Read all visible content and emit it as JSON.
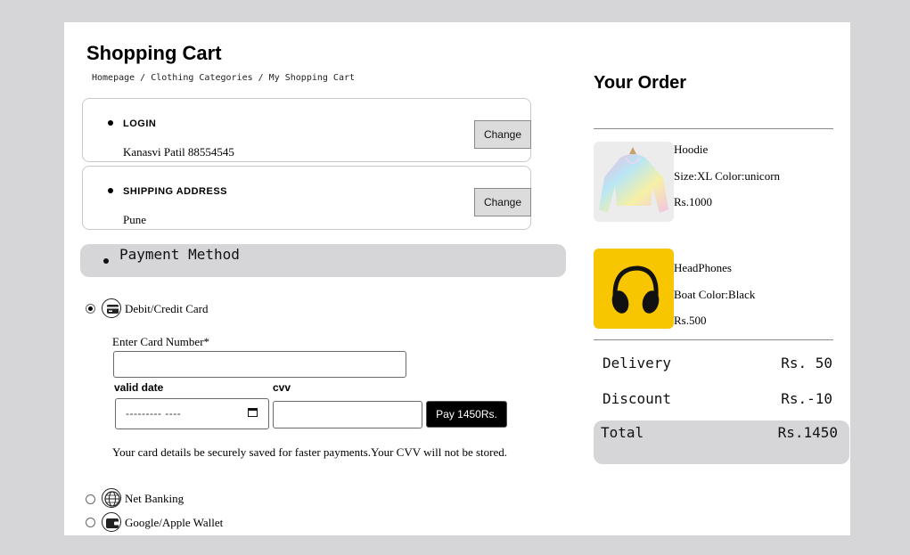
{
  "page": {
    "title": "Shopping Cart"
  },
  "breadcrumb": {
    "text": "Homepage / Clothing Categories / My Shopping Cart"
  },
  "login": {
    "heading": "LOGIN",
    "value": "Kanasvi Patil 88554545",
    "change_label": "Change"
  },
  "shipping": {
    "heading": "SHIPPING ADDRESS",
    "value": "Pune",
    "change_label": "Change"
  },
  "payment": {
    "heading": "Payment Method",
    "methods": [
      {
        "label": "Debit/Credit Card",
        "icon": "credit-card-icon",
        "selected": true
      },
      {
        "label": "Net Banking",
        "icon": "globe-icon",
        "selected": false
      },
      {
        "label": "Google/Apple Wallet",
        "icon": "wallet-icon",
        "selected": false
      }
    ],
    "card_number_label": "Enter Card Number*",
    "card_number_value": "",
    "valid_date_label": "valid date",
    "valid_date_placeholder": "--------- ----",
    "cvv_label": "cvv",
    "cvv_value": "",
    "pay_button_label": "Pay 1450Rs.",
    "note": "Your card details be securely saved for faster payments.Your CVV will not be stored."
  },
  "order": {
    "title": "Your Order",
    "items": [
      {
        "name": "Hoodie",
        "details": "Size:XL Color:unicorn",
        "price": "Rs.1000",
        "image": "hoodie-image"
      },
      {
        "name": "HeadPhones",
        "details": "Boat Color:Black",
        "price": "Rs.500",
        "image": "headphones-image"
      }
    ],
    "delivery_label": "Delivery",
    "delivery_value": "Rs. 50",
    "discount_label": "Discount",
    "discount_value": "Rs.-10",
    "total_label": "Total",
    "total_value": "Rs.1450"
  },
  "colors": {
    "page_bg": "#d6d6d8",
    "panel_bg": "#ffffff",
    "highlight_bg": "#d6d6d8",
    "pay_button": "#000000",
    "headphones_bg": "#f7c600"
  }
}
